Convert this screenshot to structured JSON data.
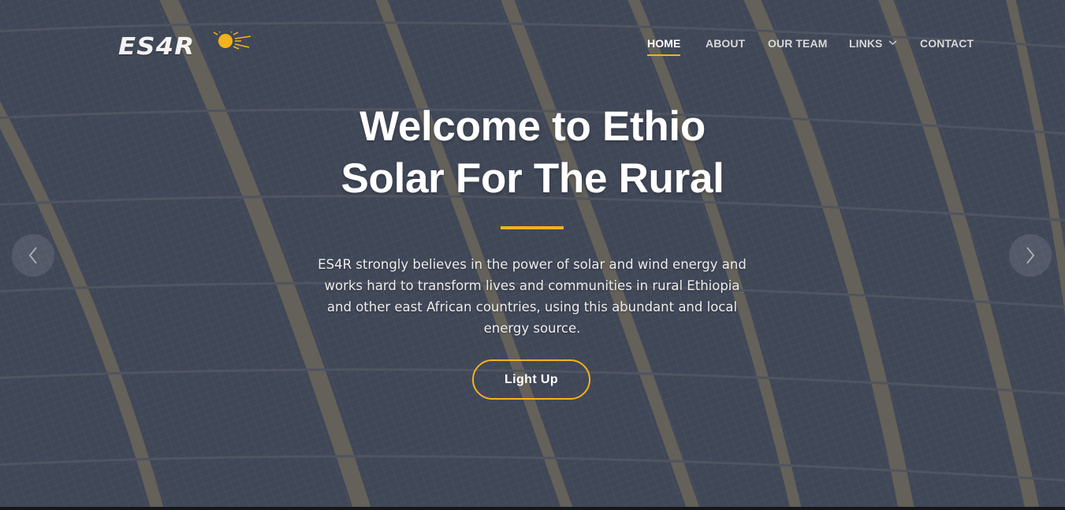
{
  "brand": {
    "logo_text": "ES4R",
    "sun_color": "#f2b31c"
  },
  "nav": {
    "items": [
      {
        "label": "HOME",
        "active": true
      },
      {
        "label": "ABOUT"
      },
      {
        "label": "OUR TEAM"
      },
      {
        "label": "LINKS",
        "has_dropdown": true
      },
      {
        "label": "CONTACT"
      }
    ]
  },
  "hero": {
    "title_line1": "Welcome to Ethio",
    "title_line2": "Solar For The Rural",
    "description": "ES4R strongly believes in the power of solar and wind energy and works hard to transform lives and communities in rural Ethiopia and other east African countries, using this abundant and local energy source.",
    "cta_label": "Light Up"
  },
  "carousel": {
    "prev_icon": "chevron-left-icon",
    "next_icon": "chevron-right-icon"
  },
  "colors": {
    "accent": "#f2b31c",
    "text": "#ffffff",
    "nav_text": "#d8d8d8"
  }
}
